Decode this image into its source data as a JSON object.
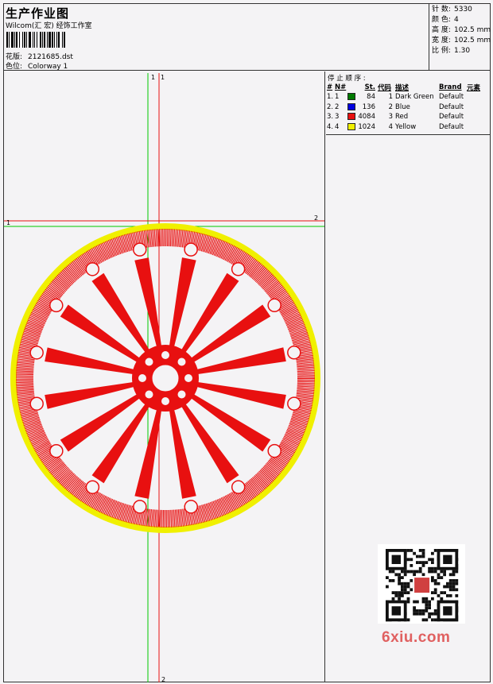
{
  "header": {
    "title": "生产作业图",
    "subtitle": "Wilcom(汇 宏) 经饰工作室",
    "pattern_label": "花版:",
    "pattern_value": "2121685.dst",
    "colorway_label": "色位:",
    "colorway_value": "Colorway 1"
  },
  "stats": [
    {
      "label": "针 数:",
      "value": "5330"
    },
    {
      "label": "颜 色:",
      "value": "4"
    },
    {
      "label": "高 度:",
      "value": "102.5 mm"
    },
    {
      "label": "宽 度:",
      "value": "102.5 mm"
    },
    {
      "label": "比 例:",
      "value": "1.30"
    }
  ],
  "design": {
    "marker_green_top": "1",
    "marker_red_top": "1",
    "marker_left": "1",
    "marker_right": "2",
    "marker_bottom": "2",
    "colors": {
      "red": "#e81010",
      "yellow": "#f0f000",
      "green": "#00c800"
    }
  },
  "stop_sequence": {
    "label": "停 止 顺 序 :",
    "headers": [
      "#",
      "N#",
      "St.",
      "代码",
      "描述",
      "Brand",
      "元素"
    ],
    "rows": [
      {
        "idx": "1.",
        "n": "1",
        "st": "84",
        "code": "1",
        "desc": "Dark Green",
        "brand": "Default",
        "color": "#007a00"
      },
      {
        "idx": "2.",
        "n": "2",
        "st": "136",
        "code": "2",
        "desc": "Blue",
        "brand": "Default",
        "color": "#0000e0"
      },
      {
        "idx": "3.",
        "n": "3",
        "st": "4084",
        "code": "3",
        "desc": "Red",
        "brand": "Default",
        "color": "#e81010"
      },
      {
        "idx": "4.",
        "n": "4",
        "st": "1024",
        "code": "4",
        "desc": "Yellow",
        "brand": "Default",
        "color": "#f0f000"
      }
    ]
  },
  "watermark": "6xiu.com"
}
